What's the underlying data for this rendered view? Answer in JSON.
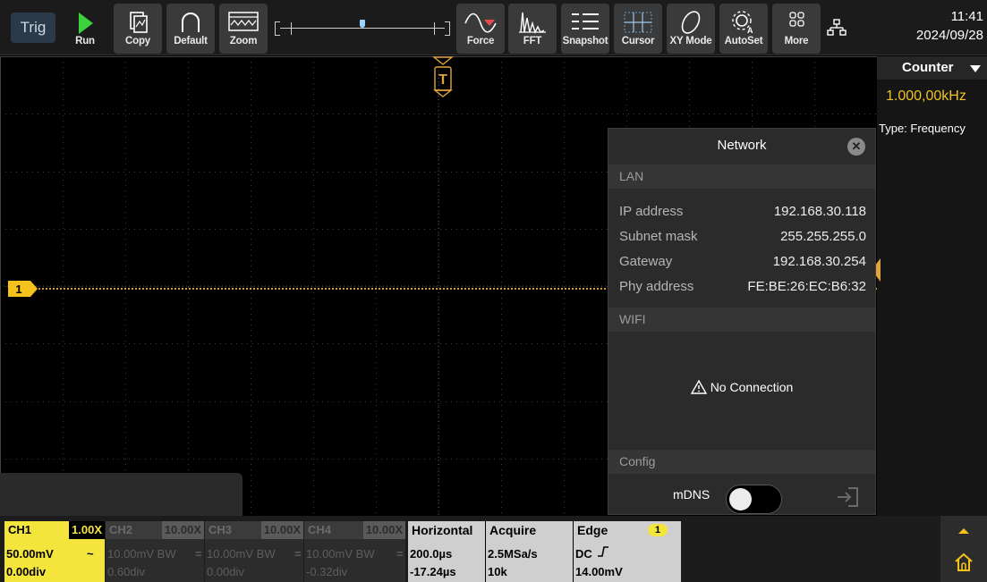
{
  "toolbar": {
    "trig_label": "Trig",
    "buttons": [
      {
        "id": "run",
        "label": "Run",
        "icon": "play-icon"
      },
      {
        "id": "copy",
        "label": "Copy",
        "icon": "copy-icon"
      },
      {
        "id": "default",
        "label": "Default",
        "icon": "default-icon"
      },
      {
        "id": "zoom",
        "label": "Zoom",
        "icon": "zoom-icon"
      },
      {
        "id": "force",
        "label": "Force",
        "icon": "force-icon"
      },
      {
        "id": "fft",
        "label": "FFT",
        "icon": "fft-icon"
      },
      {
        "id": "snapshot",
        "label": "Snapshot",
        "icon": "snapshot-icon"
      },
      {
        "id": "cursor",
        "label": "Cursor",
        "icon": "cursor-icon"
      },
      {
        "id": "xymode",
        "label": "XY Mode",
        "icon": "xy-mode-icon"
      },
      {
        "id": "autoset",
        "label": "AutoSet",
        "icon": "autoset-icon"
      },
      {
        "id": "more",
        "label": "More",
        "icon": "more-icon"
      }
    ],
    "clock_time": "11:41",
    "clock_date": "2024/09/28"
  },
  "scope": {
    "trigger_marker": "T",
    "ch1_marker": "1"
  },
  "counter": {
    "title": "Counter",
    "value": "1.000,00kHz",
    "type": "Type: Frequency"
  },
  "network": {
    "title": "Network",
    "lan_label": "LAN",
    "rows": [
      {
        "key": "IP address",
        "value": "192.168.30.118"
      },
      {
        "key": "Subnet mask",
        "value": "255.255.255.0"
      },
      {
        "key": "Gateway",
        "value": "192.168.30.254"
      },
      {
        "key": "Phy address",
        "value": "FE:BE:26:EC:B6:32"
      }
    ],
    "wifi_label": "WIFI",
    "wifi_status": "No Connection",
    "config_label": "Config",
    "mdns_label": "mDNS",
    "mdns_enabled": false
  },
  "channels": [
    {
      "name": "CH1",
      "probe": "1.00X",
      "scale": "50.00mV",
      "coupling": "~",
      "offset": "0.00div",
      "active": true
    },
    {
      "name": "CH2",
      "probe": "10.00X",
      "scale": "10.00mV BW",
      "coupling": "=",
      "offset": "0.60div",
      "active": false
    },
    {
      "name": "CH3",
      "probe": "10.00X",
      "scale": "10.00mV BW",
      "coupling": "=",
      "offset": "0.00div",
      "active": false
    },
    {
      "name": "CH4",
      "probe": "10.00X",
      "scale": "10.00mV BW",
      "coupling": "=",
      "offset": "-0.32div",
      "active": false
    }
  ],
  "horizontal": {
    "title": "Horizontal",
    "timebase": "200.0µs",
    "delay": "-17.24µs"
  },
  "acquire": {
    "title": "Acquire",
    "rate": "2.5MSa/s",
    "depth": "10k"
  },
  "trigger": {
    "title": "Edge",
    "source_badge": "1",
    "coupling": "DC",
    "level": "14.00mV"
  }
}
